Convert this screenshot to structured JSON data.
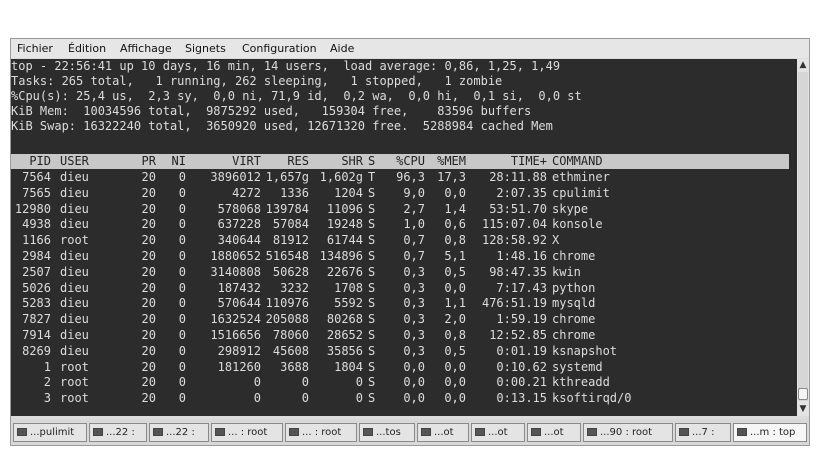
{
  "menubar": {
    "items": [
      "Fichier",
      "Édition",
      "Affichage",
      "Signets",
      "Configuration",
      "Aide"
    ]
  },
  "summary": [
    "top - 22:56:41 up 10 days, 16 min, 14 users,  load average: 0,86, 1,25, 1,49",
    "Tasks: 265 total,   1 running, 262 sleeping,   1 stopped,   1 zombie",
    "%Cpu(s): 25,4 us,  2,3 sy,  0,0 ni, 71,9 id,  0,2 wa,  0,0 hi,  0,1 si,  0,0 st",
    "KiB Mem:  10034596 total,  9875292 used,   159304 free,    83596 buffers",
    "KiB Swap: 16322240 total,  3650920 used, 12671320 free.  5288984 cached Mem"
  ],
  "columns": [
    "PID",
    "USER",
    "PR",
    "NI",
    "VIRT",
    "RES",
    "SHR",
    "S",
    "%CPU",
    "%MEM",
    "TIME+",
    "COMMAND"
  ],
  "processes": [
    [
      "7564",
      "dieu",
      "20",
      "0",
      "3896012",
      "1,657g",
      "1,602g",
      "T",
      "96,3",
      "17,3",
      "28:11.88",
      "ethminer"
    ],
    [
      "7565",
      "dieu",
      "20",
      "0",
      "4272",
      "1336",
      "1204",
      "S",
      "9,0",
      "0,0",
      "2:07.35",
      "cpulimit"
    ],
    [
      "12980",
      "dieu",
      "20",
      "0",
      "578068",
      "139784",
      "11096",
      "S",
      "2,7",
      "1,4",
      "53:51.70",
      "skype"
    ],
    [
      "4938",
      "dieu",
      "20",
      "0",
      "637228",
      "57084",
      "19248",
      "S",
      "1,0",
      "0,6",
      "115:07.04",
      "konsole"
    ],
    [
      "1166",
      "root",
      "20",
      "0",
      "340644",
      "81912",
      "61744",
      "S",
      "0,7",
      "0,8",
      "128:58.92",
      "X"
    ],
    [
      "2984",
      "dieu",
      "20",
      "0",
      "1880652",
      "516548",
      "134896",
      "S",
      "0,7",
      "5,1",
      "1:48.16",
      "chrome"
    ],
    [
      "2507",
      "dieu",
      "20",
      "0",
      "3140808",
      "50628",
      "22676",
      "S",
      "0,3",
      "0,5",
      "98:47.35",
      "kwin"
    ],
    [
      "5026",
      "dieu",
      "20",
      "0",
      "187432",
      "3232",
      "1708",
      "S",
      "0,3",
      "0,0",
      "7:17.43",
      "python"
    ],
    [
      "5283",
      "dieu",
      "20",
      "0",
      "570644",
      "110976",
      "5592",
      "S",
      "0,3",
      "1,1",
      "476:51.19",
      "mysqld"
    ],
    [
      "7827",
      "dieu",
      "20",
      "0",
      "1632524",
      "205088",
      "80268",
      "S",
      "0,3",
      "2,0",
      "1:59.19",
      "chrome"
    ],
    [
      "7914",
      "dieu",
      "20",
      "0",
      "1516656",
      "78060",
      "28652",
      "S",
      "0,3",
      "0,8",
      "12:52.85",
      "chrome"
    ],
    [
      "8269",
      "dieu",
      "20",
      "0",
      "298912",
      "45608",
      "35856",
      "S",
      "0,3",
      "0,5",
      "0:01.19",
      "ksnapshot"
    ],
    [
      "1",
      "root",
      "20",
      "0",
      "181260",
      "3688",
      "1804",
      "S",
      "0,0",
      "0,0",
      "0:10.62",
      "systemd"
    ],
    [
      "2",
      "root",
      "20",
      "0",
      "0",
      "0",
      "0",
      "S",
      "0,0",
      "0,0",
      "0:00.21",
      "kthreadd"
    ],
    [
      "3",
      "root",
      "20",
      "0",
      "0",
      "0",
      "0",
      "S",
      "0,0",
      "0,0",
      "0:13.15",
      "ksoftirqd/0"
    ]
  ],
  "tabs": [
    "...pulimit",
    "...22 :",
    "...22 :",
    "... : root",
    "... : root",
    "...tos",
    "...ot",
    "...ot",
    "...ot",
    "...90 : root",
    "...7 :",
    "...m : top"
  ],
  "icons": {
    "scroll_up": "▲",
    "scroll_down": "▼"
  }
}
